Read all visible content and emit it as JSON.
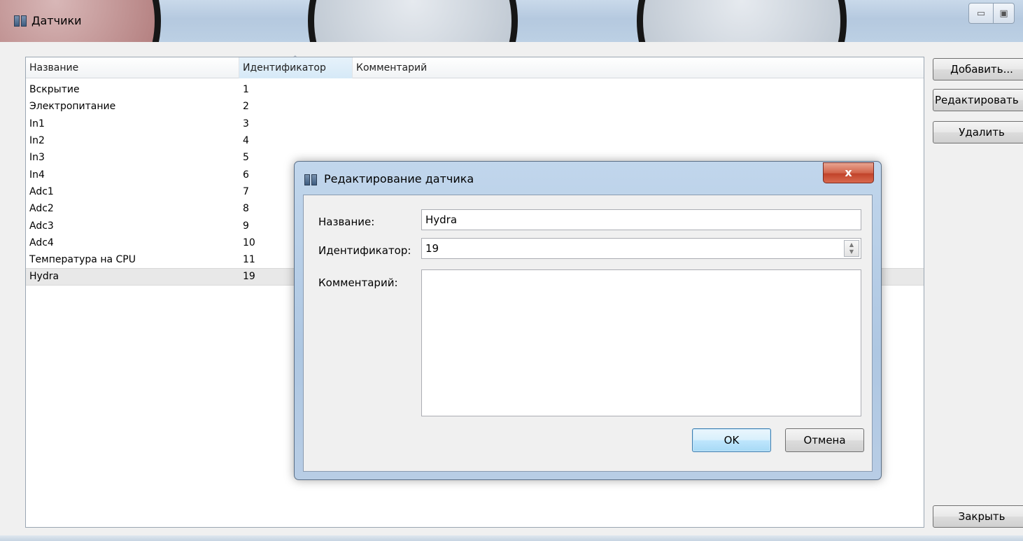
{
  "window": {
    "title": "Датчики",
    "minimize_icon": "minimize-icon",
    "maximize_icon": "maximize-icon"
  },
  "table": {
    "columns": [
      "Название",
      "Идентификатор",
      "Комментарий"
    ],
    "sort_indicator": "^",
    "rows": [
      {
        "name": "Вскрытие",
        "id": "1"
      },
      {
        "name": "Электропитание",
        "id": "2"
      },
      {
        "name": "In1",
        "id": "3"
      },
      {
        "name": "In2",
        "id": "4"
      },
      {
        "name": "In3",
        "id": "5"
      },
      {
        "name": "In4",
        "id": "6"
      },
      {
        "name": "Adc1",
        "id": "7"
      },
      {
        "name": "Adc2",
        "id": "8"
      },
      {
        "name": "Adc3",
        "id": "9"
      },
      {
        "name": "Adc4",
        "id": "10"
      },
      {
        "name": "Температура на CPU",
        "id": "11"
      },
      {
        "name": "Hydra",
        "id": "19"
      }
    ],
    "selected_row": 11
  },
  "side_buttons": {
    "add": "Добавить...",
    "edit": "Редактировать",
    "delete": "Удалить",
    "close": "Закрыть"
  },
  "dialog": {
    "title": "Редактирование датчика",
    "close_glyph": "x",
    "name_label": "Название:",
    "name_value": "Hydra",
    "id_label": "Идентификатор:",
    "id_value": "19",
    "comment_label": "Комментарий:",
    "comment_value": "",
    "ok": "OK",
    "cancel": "Отмена"
  },
  "colors": {
    "accent": "#3c7fb1",
    "close_button": "#c1432a",
    "selection": "#e8e8e8"
  }
}
